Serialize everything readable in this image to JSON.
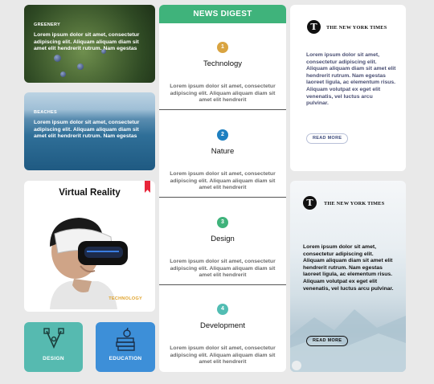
{
  "cards": {
    "greenery": {
      "category": "GREENERY",
      "text": "Lorem ipsum dolor sit amet, consectetur adipiscing elit. Aliquam aliquam diam sit amet elit hendrerit rutrum. Nam egestas"
    },
    "beaches": {
      "category": "BEACHES",
      "text": "Lorem ipsum dolor sit amet, consectetur adipiscing elit. Aliquam aliquam diam sit amet elit hendrerit rutrum. Nam egestas"
    },
    "vr": {
      "title": "Virtual Reality",
      "category": "TECHNOLOGY"
    }
  },
  "tiles": {
    "design": "DESIGN",
    "education": "EDUCATION"
  },
  "digest": {
    "title": "NEWS DIGEST",
    "sections": [
      {
        "num": "1",
        "name": "Technology",
        "color": "#d9a441",
        "text": "Lorem ipsum dolor sit amet, consectetur adipiscing elit. Aliquam aliquam diam sit amet elit hendrerit"
      },
      {
        "num": "2",
        "name": "Nature",
        "color": "#1e7fc0",
        "text": "Lorem ipsum dolor sit amet, consectetur adipiscing elit. Aliquam aliquam diam sit amet elit hendrerit"
      },
      {
        "num": "3",
        "name": "Design",
        "color": "#3fb37b",
        "text": "Lorem ipsum dolor sit amet, consectetur adipiscing elit. Aliquam aliquam diam sit amet elit hendrerit"
      },
      {
        "num": "4",
        "name": "Development",
        "color": "#52bdb3",
        "text": "Lorem ipsum dolor sit amet, consectetur adipiscing elit. Aliquam aliquam diam sit amet elit hendrerit"
      }
    ]
  },
  "nyt": {
    "top": {
      "logo": "T",
      "name": "THE NEW YORK TIMES",
      "text": "Lorem ipsum dolor sit amet, consectetur adipiscing elit. Aliquam aliquam diam sit amet elit hendrerit rutrum. Nam egestas laoreet ligula, ac elementum risus. Aliquam volutpat ex eget elit venenatis, vel luctus arcu pulvinar.",
      "button": "READ MORE"
    },
    "bottom": {
      "logo": "T",
      "name": "THE NEW YORK TIMES",
      "text": "Lorem ipsum dolor sit amet, consectetur adipiscing elit. Aliquam aliquam diam sit amet elit hendrerit rutrum. Nam egestas laoreet ligula, ac elementum risus. Aliquam volutpat ex eget elit venenatis, vel luctus arcu pulvinar.",
      "button": "READ MORE"
    }
  }
}
